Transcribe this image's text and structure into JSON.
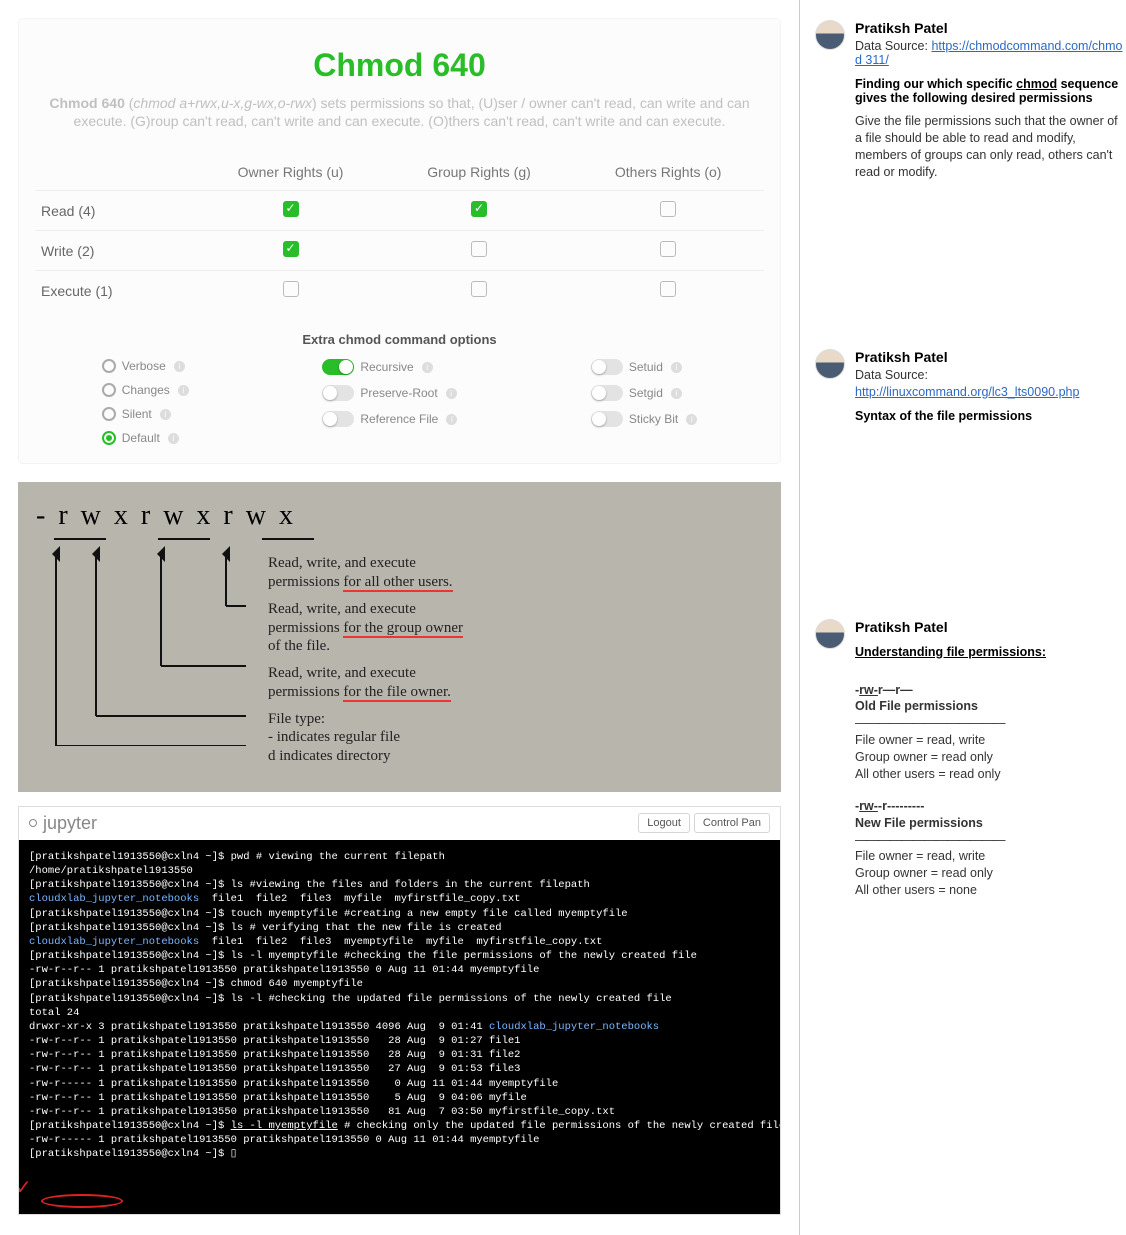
{
  "card": {
    "title": "Chmod 640",
    "desc_html": "<b>Chmod 640</b> (<i>chmod a+rwx,u-x,g-wx,o-rwx</i>) sets permissions so that, (U)ser / owner can't read, can write and can execute. (G)roup can't read, can't write and can execute. (O)thers can't read, can't write and can execute.",
    "cols": [
      "Owner Rights (u)",
      "Group Rights (g)",
      "Others Rights (o)"
    ],
    "rows": [
      {
        "label": "Read (4)",
        "vals": [
          true,
          true,
          false
        ]
      },
      {
        "label": "Write (2)",
        "vals": [
          true,
          false,
          false
        ]
      },
      {
        "label": "Execute (1)",
        "vals": [
          false,
          false,
          false
        ]
      }
    ],
    "extras_title": "Extra chmod command options",
    "radios": [
      {
        "label": "Verbose",
        "on": false
      },
      {
        "label": "Changes",
        "on": false
      },
      {
        "label": "Silent",
        "on": false
      },
      {
        "label": "Default",
        "on": true
      }
    ],
    "switches": [
      {
        "label": "Recursive",
        "on": true
      },
      {
        "label": "Preserve-Root",
        "on": false
      },
      {
        "label": "Reference File",
        "on": false
      }
    ],
    "switches2": [
      {
        "label": "Setuid",
        "on": false
      },
      {
        "label": "Setgid",
        "on": false
      },
      {
        "label": "Sticky Bit",
        "on": false
      }
    ]
  },
  "diagram": {
    "symbolic": "- r w x r w x r w x",
    "l1": "Read, write, and execute",
    "l1b": "permissions for all other users.",
    "l2": "Read, write, and execute",
    "l2b": "permissions for the group owner",
    "l2c": "of the file.",
    "l3": "Read, write, and execute",
    "l3b": "permissions for the file owner.",
    "l4": "File type:",
    "l4b": "- indicates regular file",
    "l4c": "d indicates directory"
  },
  "jupyter": {
    "name": "jupyter",
    "btn1": "Logout",
    "btn2": "Control Pan",
    "terminal": "[pratikshpatel1913550@cxln4 ~]$ pwd # viewing the current filepath\n/home/pratikshpatel1913550\n[pratikshpatel1913550@cxln4 ~]$ ls #viewing the files and folders in the current filepath\n<span class=b>cloudxlab_jupyter_notebooks</span>  file1  file2  file3  myfile  myfirstfile_copy.txt\n[pratikshpatel1913550@cxln4 ~]$ touch myemptyfile #creating a new empty file called myemptyfile\n[pratikshpatel1913550@cxln4 ~]$ ls # verifying that the new file is created\n<span class=b>cloudxlab_jupyter_notebooks</span>  file1  file2  file3  myemptyfile  myfile  myfirstfile_copy.txt\n[pratikshpatel1913550@cxln4 ~]$ ls -l myemptyfile #checking the file permissions of the newly created file\n-rw-r--r-- 1 pratikshpatel1913550 pratikshpatel1913550 0 Aug 11 01:44 myemptyfile\n[pratikshpatel1913550@cxln4 ~]$ chmod 640 myemptyfile\n[pratikshpatel1913550@cxln4 ~]$ ls -l #checking the updated file permissions of the newly created file\ntotal 24\ndrwxr-xr-x 3 pratikshpatel1913550 pratikshpatel1913550 4096 Aug  9 01:41 <span class=b>cloudxlab_jupyter_notebooks</span>\n-rw-r--r-- 1 pratikshpatel1913550 pratikshpatel1913550   28 Aug  9 01:27 file1\n-rw-r--r-- 1 pratikshpatel1913550 pratikshpatel1913550   28 Aug  9 01:31 file2\n-rw-r--r-- 1 pratikshpatel1913550 pratikshpatel1913550   27 Aug  9 01:53 file3\n-rw-r----- 1 pratikshpatel1913550 pratikshpatel1913550    0 Aug 11 01:44 myemptyfile\n-rw-r--r-- 1 pratikshpatel1913550 pratikshpatel1913550    5 Aug  9 04:06 myfile\n-rw-r--r-- 1 pratikshpatel1913550 pratikshpatel1913550   81 Aug  7 03:50 myfirstfile_copy.txt\n[pratikshpatel1913550@cxln4 ~]$ <u>ls -l myemptyfile</u> # checking only the updated file permissions of the newly created file\n-rw-r----- 1 pratikshpatel1913550 pratikshpatel1913550 0 Aug 11 01:44 myemptyfile\n[pratikshpatel1913550@cxln4 ~]$ ▯"
  },
  "ann1": {
    "author": "Pratiksh Patel",
    "src_label": "Data Source: ",
    "link": "https://chmodcommand.com/chmod311/",
    "linktext": "https://chmodcommand.com/chmod 311/",
    "heading": "Finding our which specific chmod sequence gives the following desired permissions",
    "body": "Give the file permissions such that the owner of a file should be able to read and modify, members of groups can only read, others can't read or modify."
  },
  "ann2": {
    "author": "Pratiksh Patel",
    "src_label": "Data Source:",
    "link": "http://linuxcommand.org/lc3_lts0090.php",
    "heading": "Syntax of the file permissions"
  },
  "ann3": {
    "author": "Pratiksh Patel",
    "heading": "Understanding file permissions:",
    "old_perm": "-rw-r—r—",
    "old_label": "Old File permissions",
    "sep": "—————————————",
    "o1": "File owner = read, write",
    "o2": "Group owner = read only",
    "o3": "All other users = read only",
    "new_perm": "-rw--r---------",
    "new_label": "New File permissions",
    "n1": "File owner = read, write",
    "n2": "Group owner = read only",
    "n3": "All other users = none"
  }
}
